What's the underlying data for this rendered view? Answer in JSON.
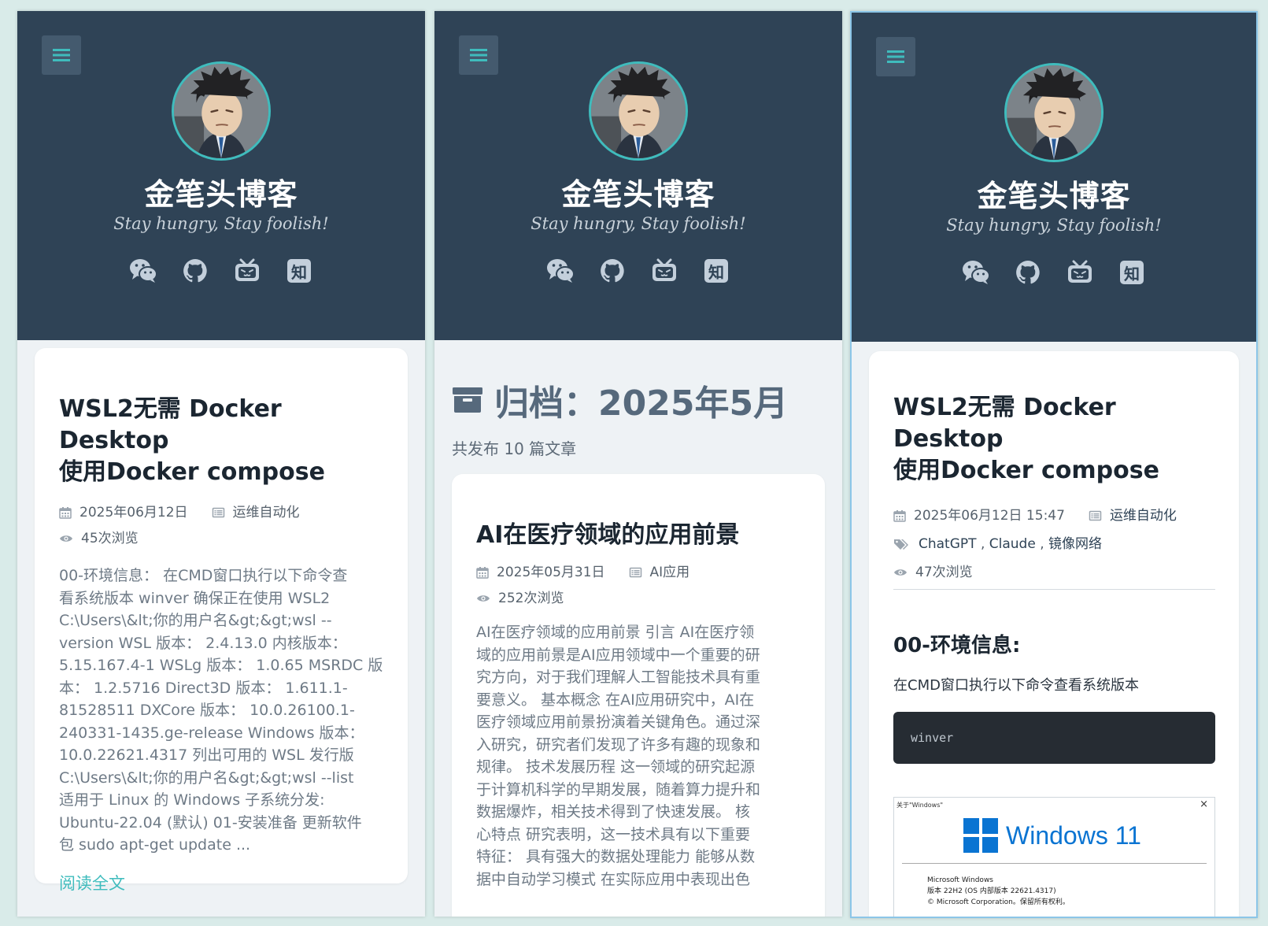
{
  "site": {
    "title": "金笔头博客",
    "subtitle": "Stay hungry, Stay foolish!",
    "zhihu_label": "知"
  },
  "panel1": {
    "post_title_line1": "WSL2无需 Docker Desktop",
    "post_title_line2": "使用Docker compose",
    "date": "2025年06月12日",
    "category": "运维自动化",
    "views": "45次浏览",
    "excerpt_lines": [
      "00-环境信息： 在CMD窗口执行以下命令查",
      "看系统版本 winver 确保正在使用 WSL2",
      "C:\\Users\\&lt;你的用户名&gt;&gt;wsl --",
      "version WSL 版本： 2.4.13.0 内核版本：",
      "5.15.167.4-1 WSLg 版本： 1.0.65 MSRDC 版",
      "本： 1.2.5716 Direct3D 版本： 1.611.1-",
      "81528511 DXCore 版本： 10.0.26100.1-",
      "240331-1435.ge-release Windows 版本：",
      "10.0.22621.4317 列出可用的 WSL 发行版",
      "C:\\Users\\&lt;你的用户名&gt;&gt;wsl --list",
      "适用于 Linux 的 Windows 子系统分发:",
      "Ubuntu-22.04 (默认) 01-安装准备 更新软件",
      "包 sudo apt-get update ..."
    ],
    "read_more": "阅读全文"
  },
  "panel2": {
    "archive_title": "归档：2025年5月",
    "count": "共发布 10 篇文章",
    "post_title": "AI在医疗领域的应用前景",
    "date": "2025年05月31日",
    "category": "AI应用",
    "views": "252次浏览",
    "excerpt_lines": [
      "AI在医疗领域的应用前景 引言 AI在医疗领",
      "域的应用前景是AI应用领域中一个重要的研",
      "究方向，对于我们理解人工智能技术具有重",
      "要意义。 基本概念 在AI应用研究中，AI在",
      "医疗领域应用前景扮演着关键角色。通过深",
      "入研究，研究者们发现了许多有趣的现象和",
      "规律。 技术发展历程 这一领域的研究起源",
      "于计算机科学的早期发展，随着算力提升和",
      "数据爆炸，相关技术得到了快速发展。 核",
      "心特点 研究表明，这一技术具有以下重要",
      "特征： 具有强大的数据处理能力 能够从数",
      "据中自动学习模式 在实际应用中表现出色"
    ]
  },
  "panel3": {
    "post_title_line1": "WSL2无需 Docker Desktop",
    "post_title_line2": "使用Docker compose",
    "datetime": "2025年06月12日 15:47",
    "category": "运维自动化",
    "tags": [
      "ChatGPT",
      "Claude",
      "镜像网络"
    ],
    "tag_sep": " , ",
    "views": "47次浏览",
    "section_heading": "00-环境信息:",
    "paragraph": "在CMD窗口执行以下命令查看系统版本",
    "code": "winver",
    "screenshot": {
      "dialog_title": "关于\"Windows\"",
      "close_glyph": "×",
      "product": "Windows 11",
      "line1": "Microsoft Windows",
      "line2": "版本 22H2 (OS 内部版本 22621.4317)",
      "line3": "© Microsoft Corporation。保留所有权利。"
    }
  },
  "colors": {
    "header_bg": "#2f4356",
    "accent": "#3fbcbd",
    "page_bg": "#eef2f5"
  },
  "icons": [
    "menu-icon",
    "wechat-icon",
    "github-icon",
    "bilibili-icon",
    "zhihu-icon",
    "calendar-icon",
    "list-icon",
    "eye-icon",
    "tags-icon",
    "archive-icon",
    "windows-logo"
  ]
}
